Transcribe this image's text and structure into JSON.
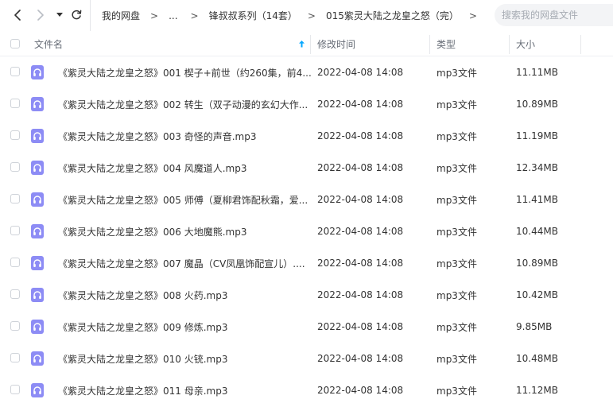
{
  "nav": {
    "back_icon": "chevron-left-icon",
    "forward_icon": "chevron-right-icon",
    "history_icon": "caret-down-icon",
    "refresh_icon": "refresh-icon"
  },
  "breadcrumb": {
    "items": [
      "我的网盘",
      "...",
      "锋叔叔系列（14套）",
      "015紫灵大陆之龙皇之怒（完）"
    ],
    "separator": ">"
  },
  "search": {
    "placeholder": "搜索我的网盘文件"
  },
  "columns": {
    "name": "文件名",
    "sort_icon": "sort-up-arrow-icon",
    "modified": "修改时间",
    "type": "类型",
    "size": "大小"
  },
  "colors": {
    "accent": "#06a7ff",
    "file_icon": "#8d8cf5"
  },
  "files": [
    {
      "name": "《紫灵大陆之龙皇之怒》001 楔子+前世（约260集，前4...",
      "modified": "2022-04-08 14:08",
      "type": "mp3文件",
      "size": "11.11MB"
    },
    {
      "name": "《紫灵大陆之龙皇之怒》002 转生（双子动漫的玄幻大作...",
      "modified": "2022-04-08 14:08",
      "type": "mp3文件",
      "size": "10.89MB"
    },
    {
      "name": "《紫灵大陆之龙皇之怒》003 奇怪的声音.mp3",
      "modified": "2022-04-08 14:08",
      "type": "mp3文件",
      "size": "11.19MB"
    },
    {
      "name": "《紫灵大陆之龙皇之怒》004 风魔道人.mp3",
      "modified": "2022-04-08 14:08",
      "type": "mp3文件",
      "size": "12.34MB"
    },
    {
      "name": "《紫灵大陆之龙皇之怒》005 师傅（夏柳君饰配秋霜，爱...",
      "modified": "2022-04-08 14:08",
      "type": "mp3文件",
      "size": "11.41MB"
    },
    {
      "name": "《紫灵大陆之龙皇之怒》006 大地魔熊.mp3",
      "modified": "2022-04-08 14:08",
      "type": "mp3文件",
      "size": "10.44MB"
    },
    {
      "name": "《紫灵大陆之龙皇之怒》007 魔晶（CV凤凰饰配宣儿）....",
      "modified": "2022-04-08 14:08",
      "type": "mp3文件",
      "size": "10.89MB"
    },
    {
      "name": "《紫灵大陆之龙皇之怒》008 火药.mp3",
      "modified": "2022-04-08 14:08",
      "type": "mp3文件",
      "size": "10.42MB"
    },
    {
      "name": "《紫灵大陆之龙皇之怒》009 修炼.mp3",
      "modified": "2022-04-08 14:08",
      "type": "mp3文件",
      "size": "9.85MB"
    },
    {
      "name": "《紫灵大陆之龙皇之怒》010 火铳.mp3",
      "modified": "2022-04-08 14:08",
      "type": "mp3文件",
      "size": "10.48MB"
    },
    {
      "name": "《紫灵大陆之龙皇之怒》011 母亲.mp3",
      "modified": "2022-04-08 14:08",
      "type": "mp3文件",
      "size": "11.12MB"
    }
  ]
}
